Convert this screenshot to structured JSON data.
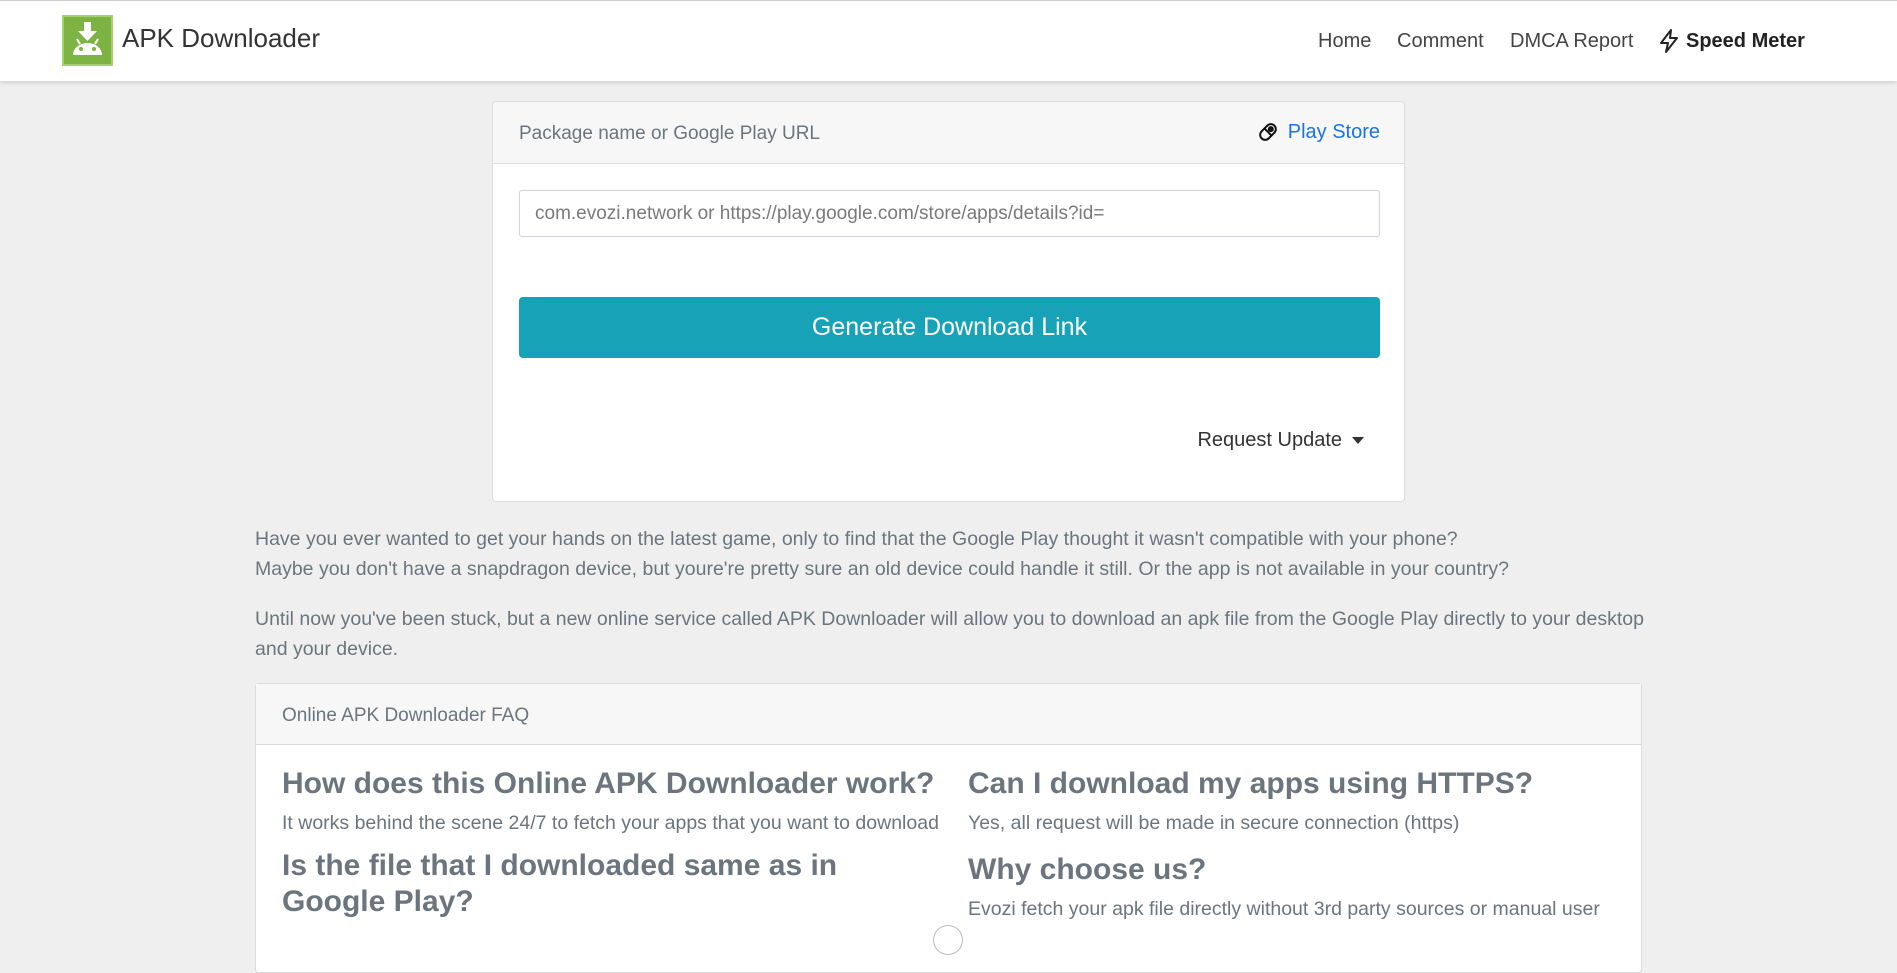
{
  "brand": {
    "name": "APK Downloader",
    "logo_icon": "android-download-icon",
    "logo_color": "#7cb342"
  },
  "nav": {
    "items": [
      {
        "label": "Home"
      },
      {
        "label": "Comment"
      },
      {
        "label": "DMCA Report"
      },
      {
        "label": "Speed Meter",
        "icon": "lightning-bolt-icon"
      }
    ]
  },
  "search_card": {
    "header_title": "Package name or Google Play URL",
    "play_store_label": "Play Store",
    "play_store_icon": "play-store-icon",
    "link_color": "#1a73e8",
    "input_placeholder": "com.evozi.network or https://play.google.com/store/apps/details?id=",
    "input_value": "",
    "generate_button_label": "Generate Download Link",
    "button_color": "#17a2b8",
    "request_update_label": "Request Update"
  },
  "intro": {
    "paragraph1_line1": "Have you ever wanted to get your hands on the latest game, only to find that the Google Play thought it wasn't compatible with your phone?",
    "paragraph1_line2": "Maybe you don't have a snapdragon device, but youre're pretty sure an old device could handle it still. Or the app is not available in your country?",
    "paragraph2": "Until now you've been stuck, but a new online service called APK Downloader will allow you to download an apk file from the Google Play directly to your desktop and your device."
  },
  "faq": {
    "header_title": "Online APK Downloader FAQ",
    "left": [
      {
        "q": "How does this Online APK Downloader work?",
        "a": "It works behind the scene 24/7 to fetch your apps that you want to download"
      },
      {
        "q": "Is the file that I downloaded same as in Google Play?",
        "a": ""
      }
    ],
    "right": [
      {
        "q": "Can I download my apps using HTTPS?",
        "a": "Yes, all request will be made in secure connection (https)"
      },
      {
        "q": "Why choose us?",
        "a": "Evozi fetch your apk file directly without 3rd party sources or manual user"
      }
    ]
  }
}
